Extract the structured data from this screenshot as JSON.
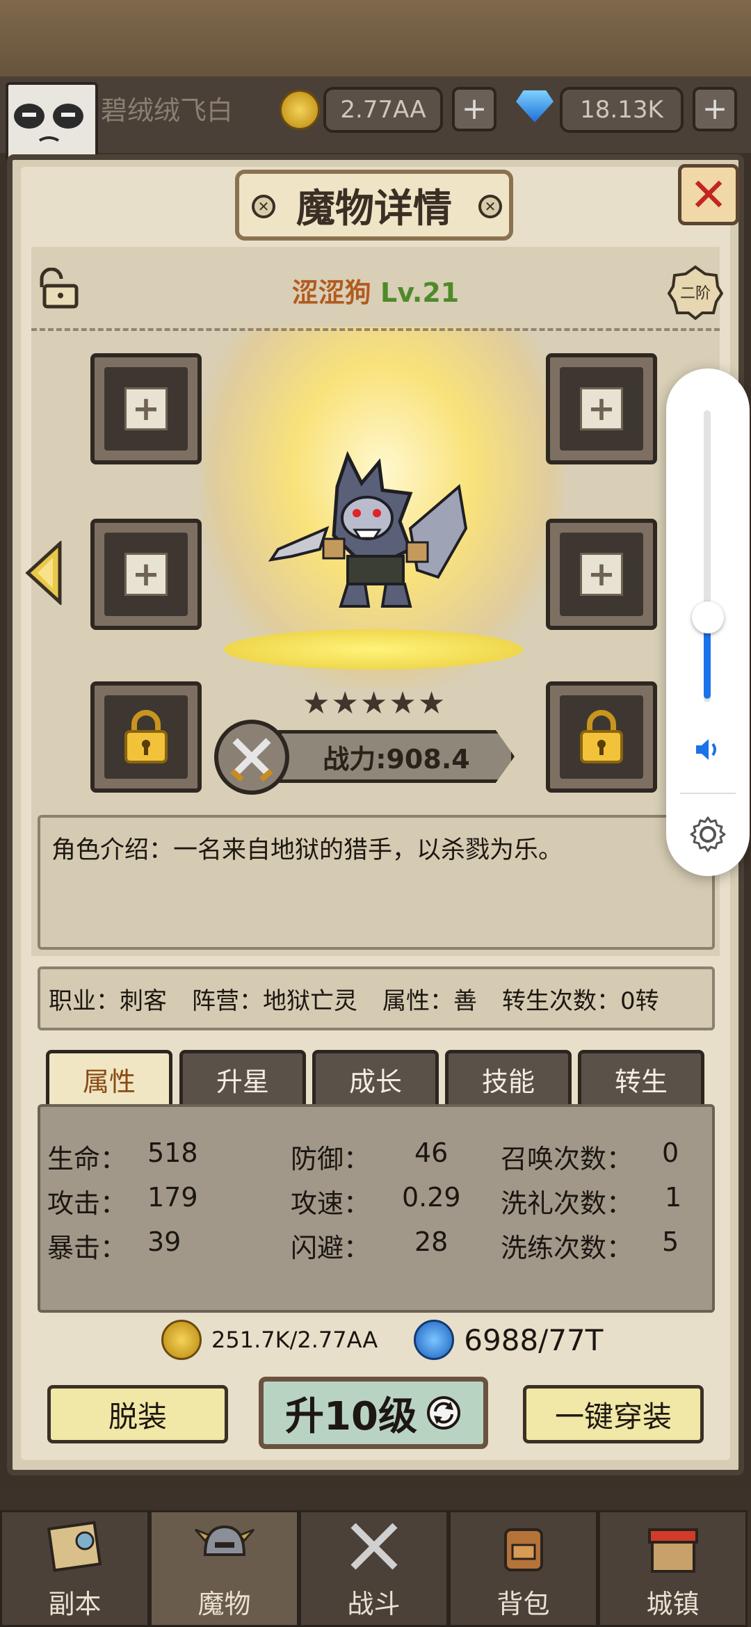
{
  "header": {
    "player_name": "碧绒绒飞白",
    "gold": "2.77AA",
    "gems": "18.13K",
    "add_gold_label": "+",
    "add_gems_label": "+"
  },
  "panel": {
    "title": "魔物详情",
    "close_label": "✕"
  },
  "monster": {
    "name": "涩涩狗",
    "level": "Lv.21",
    "rank": "二阶",
    "stars": 5,
    "power": "战力:908.4",
    "description": "角色介绍：一名来自地狱的猎手，以杀戮为乐。"
  },
  "equip_slots": {
    "add_label": "+"
  },
  "info": {
    "class": "职业：刺客",
    "faction": "阵营：地狱亡灵",
    "attribute": "属性：善",
    "rebirths": "转生次数：0转"
  },
  "tabs": [
    "属性",
    "升星",
    "成长",
    "技能",
    "转生"
  ],
  "stats": {
    "col1": [
      {
        "label": "生命：",
        "value": "518"
      },
      {
        "label": "攻击：",
        "value": "179"
      },
      {
        "label": "暴击：",
        "value": "39"
      }
    ],
    "col2": [
      {
        "label": "防御：",
        "value": "46"
      },
      {
        "label": "攻速：",
        "value": "0.29"
      },
      {
        "label": "闪避：",
        "value": "28"
      }
    ],
    "col3": [
      {
        "label": "召唤次数：",
        "value": "0"
      },
      {
        "label": "洗礼次数：",
        "value": "1"
      },
      {
        "label": "洗练次数：",
        "value": "5"
      }
    ]
  },
  "cost": {
    "gold": "251.7K/2.77AA",
    "crystal": "6988/77T"
  },
  "buttons": {
    "unequip": "脱装",
    "upgrade": "升10级",
    "equip_all": "一键穿装"
  },
  "nav": [
    "副本",
    "魔物",
    "战斗",
    "背包",
    "城镇"
  ],
  "volume": {
    "level": 0.22
  },
  "colors": {
    "accent_blue": "#1a73e8",
    "name_orange": "#b35a1e",
    "level_green": "#4f8a2a",
    "close_red": "#c3261e"
  }
}
